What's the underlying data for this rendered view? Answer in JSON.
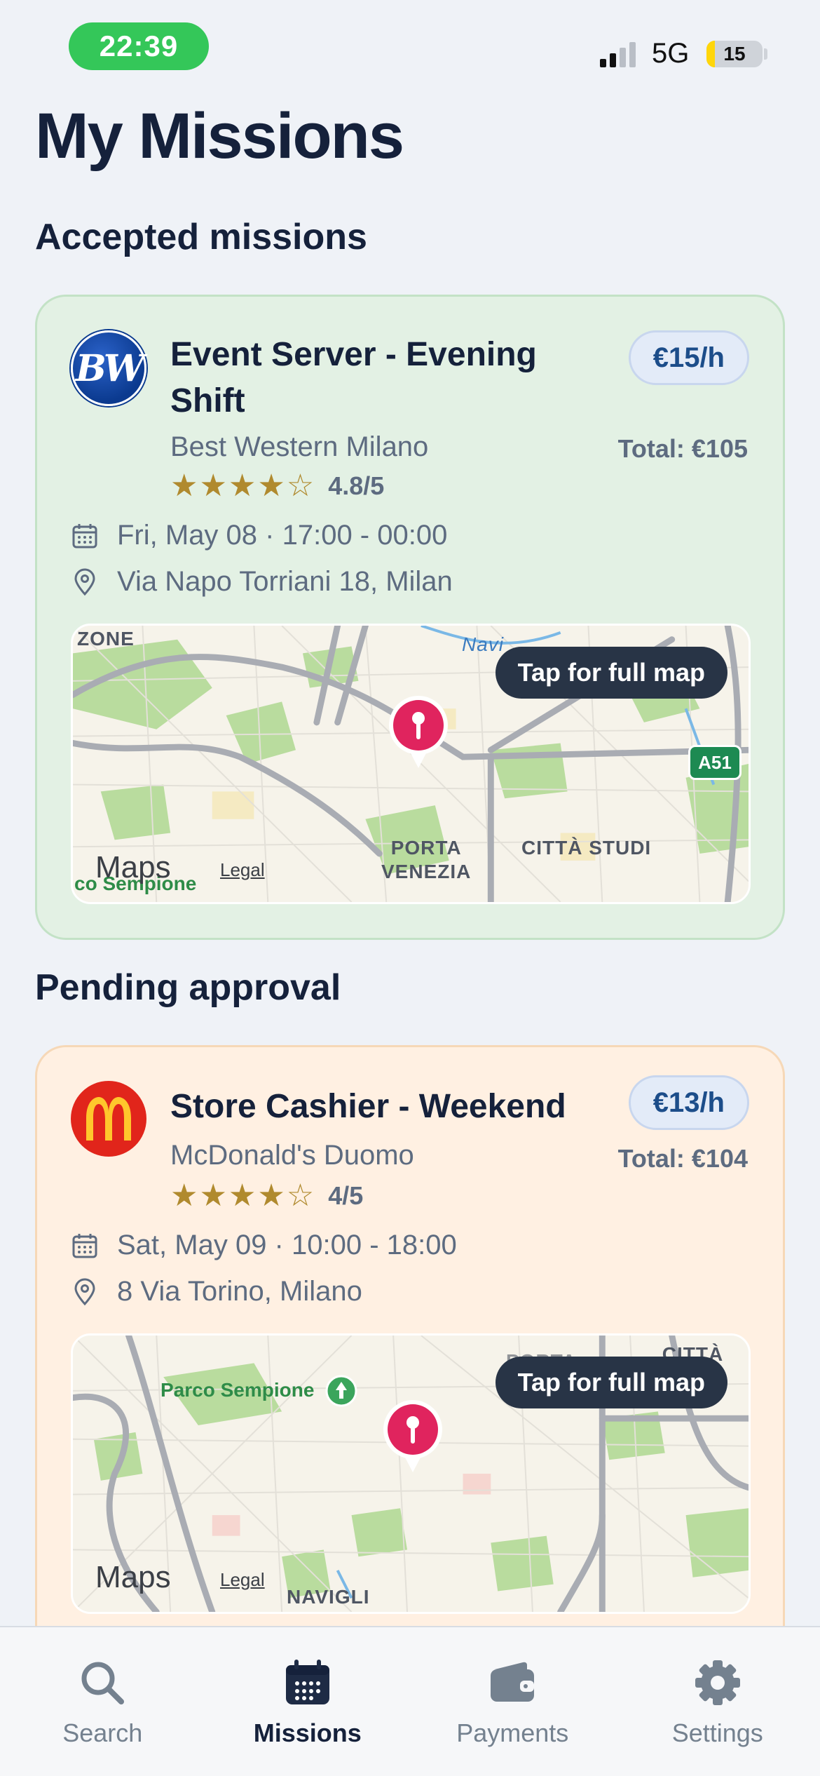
{
  "status_bar": {
    "time": "22:39",
    "network": "5G",
    "battery": "15",
    "battery_level_percent": 15
  },
  "page_title": "My Missions",
  "sections": {
    "accepted_title": "Accepted missions",
    "pending_title": "Pending approval"
  },
  "accepted_mission": {
    "logo_text": "BW",
    "title": "Event Server - Evening Shift",
    "company": "Best Western Milano",
    "stars": "★★★★☆",
    "rating": "4.8/5",
    "rate": "€15/h",
    "total": "Total: €105",
    "date": "Fri, May 08 · 17:00 - 00:00",
    "address": "Via Napo Torriani 18, Milan",
    "map": {
      "button_label": "Tap for full map",
      "maps_brand": "Maps",
      "legal": "Legal",
      "labels": {
        "zone": "ZONE",
        "navi": "Navi",
        "porta_venezia": "PORTA\nVENEZIA",
        "citta_studi": "CITTÀ STUDI",
        "sempione": "co Sempione",
        "highway": "A51"
      }
    }
  },
  "pending_mission": {
    "title": "Store Cashier - Weekend",
    "company": "McDonald's Duomo",
    "stars": "★★★★☆",
    "rating": "4/5",
    "rate": "€13/h",
    "total": "Total: €104",
    "date": "Sat, May 09 · 10:00 - 18:00",
    "address": "8 Via Torino, Milano",
    "map": {
      "button_label": "Tap for full map",
      "maps_brand": "Maps",
      "legal": "Legal",
      "labels": {
        "parco": "Parco Sempione",
        "porta": "PORTA",
        "citta_studi": "CITTÀ STUD",
        "navigli": "NAVIGLI"
      }
    }
  },
  "tab_bar": {
    "tabs": [
      {
        "label": "Search",
        "icon": "search-icon",
        "active": false
      },
      {
        "label": "Missions",
        "icon": "calendar-icon",
        "active": true
      },
      {
        "label": "Payments",
        "icon": "wallet-icon",
        "active": false
      },
      {
        "label": "Settings",
        "icon": "gear-icon",
        "active": false
      }
    ]
  },
  "colors": {
    "accent": "#15213b",
    "accepted_card": "#e3f1e4",
    "pending_card": "#fff0e2",
    "pin": "#e0245e",
    "time_pill": "#34c759"
  }
}
